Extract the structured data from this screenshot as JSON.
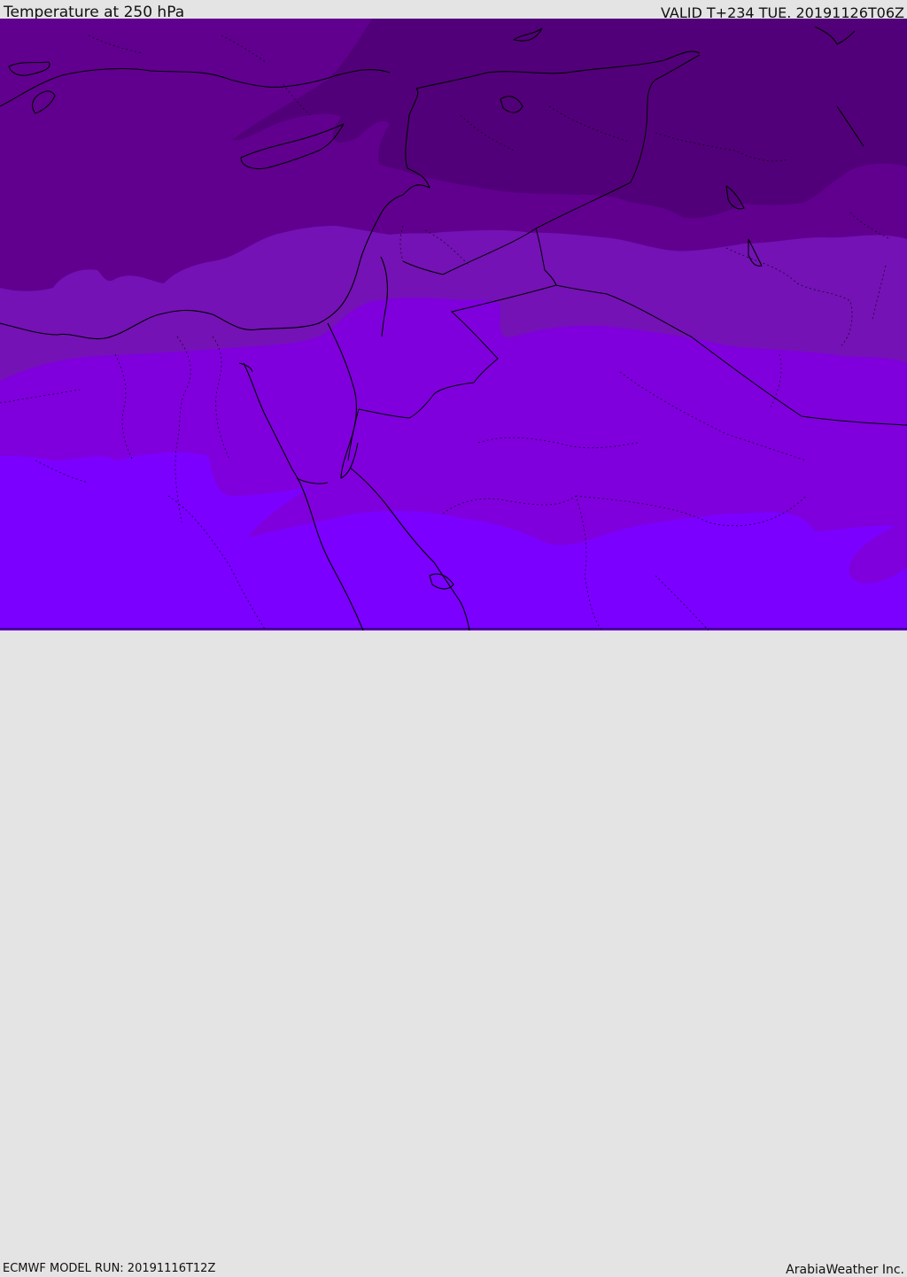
{
  "header": {
    "title": "Temperature at 250 hPa",
    "valid": "VALID T+234 TUE. 20191126T06Z"
  },
  "footer": {
    "model_run": "ECMWF MODEL RUN: 20191116T12Z",
    "credit": "ArabiaWeather Inc."
  },
  "colors": {
    "band_coldest": "#520079",
    "band_cold": "#61008f",
    "band_mid": "#7412b5",
    "band_warm": "#7f00dc",
    "band_warmest": "#7b00ff",
    "coastline": "#000000",
    "border": "#000000"
  }
}
